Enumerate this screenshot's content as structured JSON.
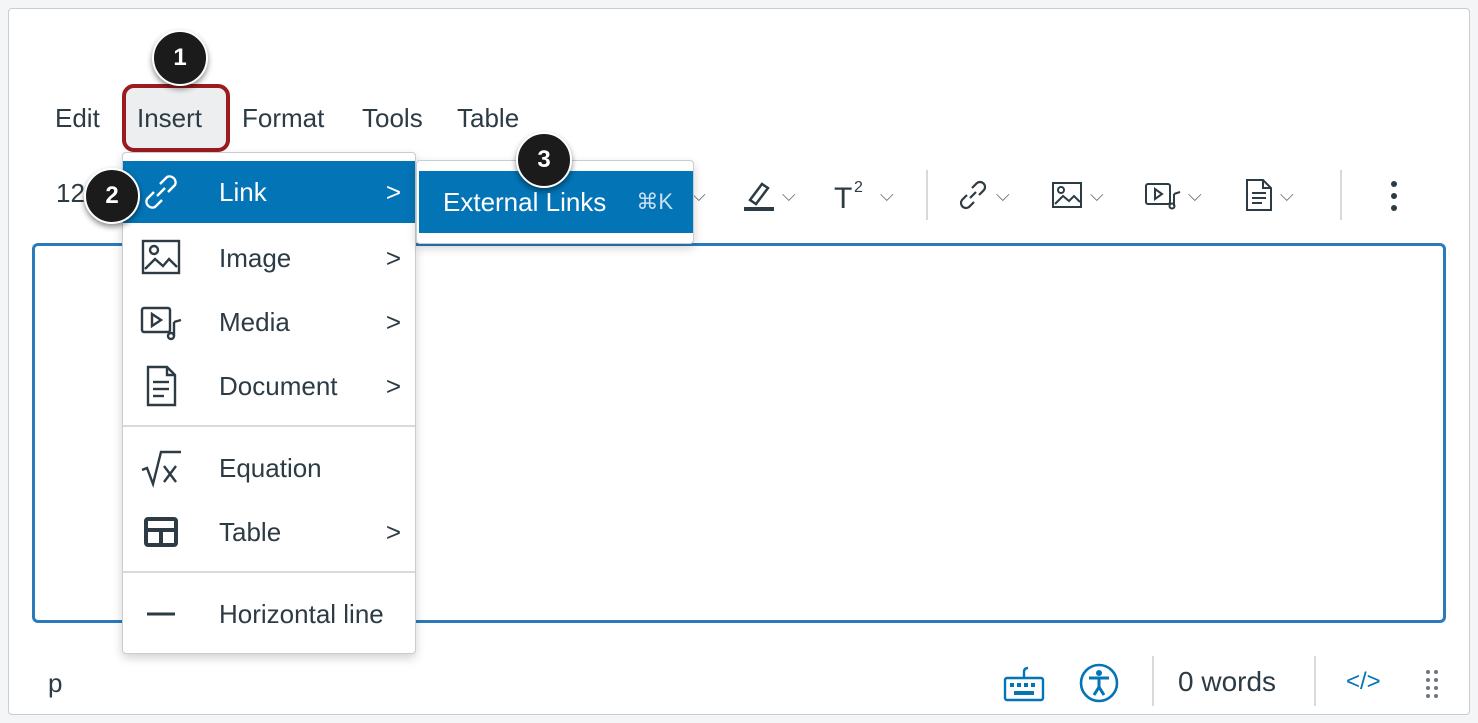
{
  "menubar": {
    "items": [
      "Edit",
      "Insert",
      "Format",
      "Tools",
      "Table"
    ]
  },
  "toolbar": {
    "font_size_partial": "12",
    "more_icon": "vertical-ellipsis-icon"
  },
  "insert_menu": {
    "items": [
      {
        "label": "Link",
        "icon": "link-icon",
        "has_submenu": true,
        "active": true
      },
      {
        "label": "Image",
        "icon": "image-icon",
        "has_submenu": true
      },
      {
        "label": "Media",
        "icon": "media-icon",
        "has_submenu": true
      },
      {
        "label": "Document",
        "icon": "document-icon",
        "has_submenu": true
      },
      {
        "label": "Equation",
        "icon": "equation-icon",
        "has_submenu": false
      },
      {
        "label": "Table",
        "icon": "table-icon",
        "has_submenu": true
      },
      {
        "label": "Horizontal line",
        "icon": "horizontal-line-icon",
        "has_submenu": false
      }
    ],
    "arrow": ">"
  },
  "link_submenu": {
    "label": "External Links",
    "shortcut": "⌘K"
  },
  "callouts": [
    "1",
    "2",
    "3"
  ],
  "statusbar": {
    "element_path": "p",
    "word_count": "0 words",
    "html_toggle": "</>"
  },
  "colors": {
    "accent": "#0374b5",
    "callout_border": "#9b1b1f",
    "editor_border": "#2b7abc",
    "text": "#2d3b45"
  }
}
